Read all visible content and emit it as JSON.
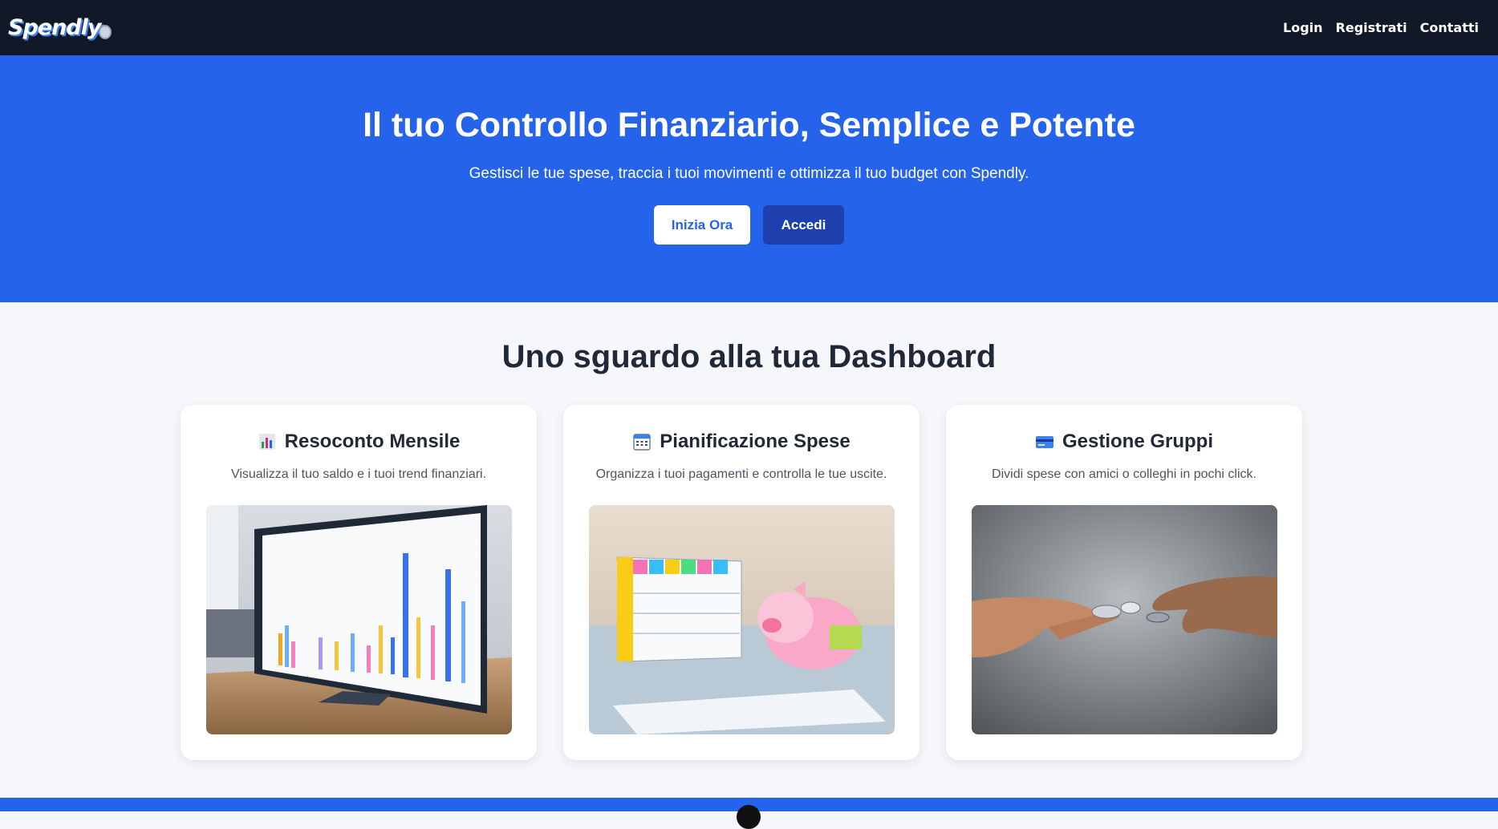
{
  "navbar": {
    "logo_text": "Spendly",
    "links": [
      {
        "label": "Login"
      },
      {
        "label": "Registrati"
      },
      {
        "label": "Contatti"
      }
    ]
  },
  "hero": {
    "title": "Il tuo Controllo Finanziario, Semplice e Potente",
    "subtitle": "Gestisci le tue spese, traccia i tuoi movimenti e ottimizza il tuo budget con Spendly.",
    "primary_button": "Inizia Ora",
    "secondary_button": "Accedi"
  },
  "dashboard": {
    "title": "Uno sguardo alla tua Dashboard",
    "cards": [
      {
        "icon": "bar-chart-icon",
        "title": "Resoconto Mensile",
        "description": "Visualizza il tuo saldo e i tuoi trend finanziari.",
        "image": "monitor-with-bar-chart-image"
      },
      {
        "icon": "calendar-icon",
        "title": "Pianificazione Spese",
        "description": "Organizza i tuoi pagamenti e controlla le tue uscite.",
        "image": "calendar-and-piggy-bank-image"
      },
      {
        "icon": "credit-card-icon",
        "title": "Gestione Gruppi",
        "description": "Dividi spese con amici o colleghi in pochi click.",
        "image": "hands-exchanging-coins-image"
      }
    ]
  },
  "colors": {
    "navbar_bg": "#111827",
    "hero_bg": "#2563eb",
    "secondary_button_bg": "#1e40af",
    "page_bg": "#f5f7fb"
  }
}
